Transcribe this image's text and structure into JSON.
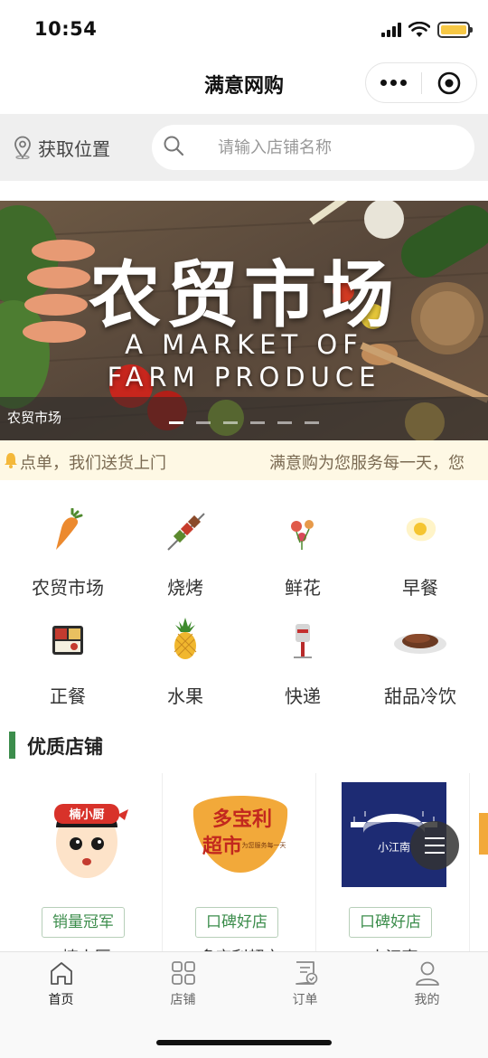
{
  "status": {
    "time": "10:54"
  },
  "nav": {
    "title": "满意网购"
  },
  "search": {
    "location_label": "获取位置",
    "placeholder": "请输入店铺名称"
  },
  "banner": {
    "title": "农贸市场",
    "subtitle_line1": "A MARKET OF",
    "subtitle_line2": "FARM PRODUCE",
    "caption": "农贸市场",
    "slide_count": 6,
    "active_slide": 0
  },
  "notice": {
    "text1": "点单，我们送货上门",
    "text2": "满意购为您服务每一天，您"
  },
  "categories": [
    {
      "label": "农贸市场",
      "icon": "carrot-icon"
    },
    {
      "label": "烧烤",
      "icon": "skewer-icon"
    },
    {
      "label": "鲜花",
      "icon": "flower-icon"
    },
    {
      "label": "早餐",
      "icon": "egg-icon"
    },
    {
      "label": "正餐",
      "icon": "bento-icon"
    },
    {
      "label": "水果",
      "icon": "pineapple-icon"
    },
    {
      "label": "快递",
      "icon": "mailbox-icon"
    },
    {
      "label": "甜品冷饮",
      "icon": "dessert-icon"
    }
  ],
  "section": {
    "title": "优质店铺"
  },
  "stores": [
    {
      "tag": "销量冠军",
      "logo_text": "楠小厨",
      "name": "楠小厨"
    },
    {
      "tag": "口碑好店",
      "logo_text": "多宝利 超市",
      "logo_sub": "为您服务每一天",
      "name": "多宝利超市"
    },
    {
      "tag": "口碑好店",
      "logo_text": "小江南",
      "name": "小江南"
    }
  ],
  "tabs": [
    {
      "label": "首页",
      "icon": "home-icon",
      "active": true
    },
    {
      "label": "店铺",
      "icon": "grid-icon",
      "active": false
    },
    {
      "label": "订单",
      "icon": "order-icon",
      "active": false
    },
    {
      "label": "我的",
      "icon": "user-icon",
      "active": false
    }
  ],
  "colors": {
    "accent": "#3c8d4c",
    "notice_bg": "#fef8e4",
    "search_bg": "#efefef"
  }
}
